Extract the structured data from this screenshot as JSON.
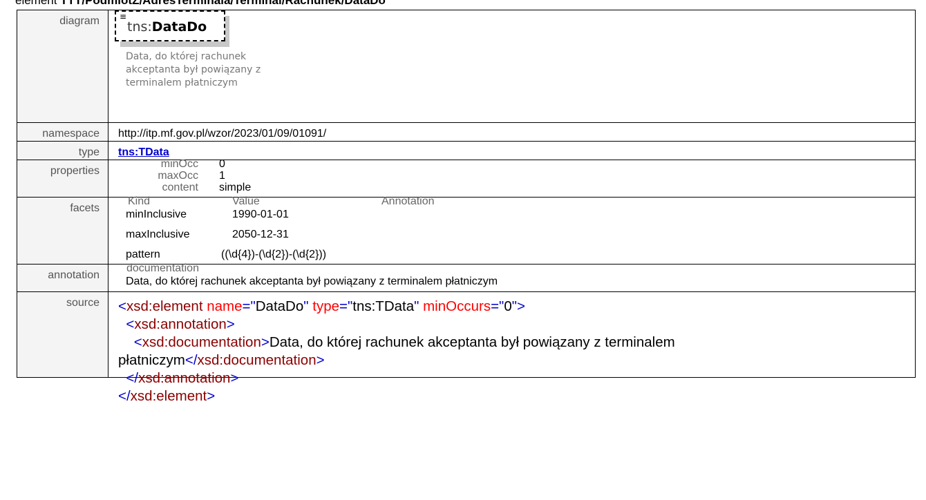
{
  "title": {
    "prefix": "element ",
    "path": "TTT/PodmiotZ/AdresTerminala/Terminal/Rachunek/DataDo"
  },
  "labels": {
    "diagram": "diagram",
    "namespace": "namespace",
    "type": "type",
    "properties": "properties",
    "facets": "facets",
    "annotation": "annotation",
    "source": "source"
  },
  "diagram": {
    "icon": "≡",
    "prefix": "tns:",
    "name": "DataDo",
    "doc_lines": [
      "Data, do której rachunek",
      "akceptanta był powiązany z",
      "terminalem płatniczym"
    ]
  },
  "namespace": "http://itp.mf.gov.pl/wzor/2023/01/09/01091/",
  "type": "tns:TData",
  "properties": [
    {
      "key": "minOcc",
      "value": "0"
    },
    {
      "key": "maxOcc",
      "value": "1"
    },
    {
      "key": "content",
      "value": "simple"
    }
  ],
  "facets": {
    "headers": [
      "Kind",
      "Value",
      "Annotation"
    ],
    "rows": [
      {
        "kind": "minInclusive",
        "value": "1990-01-01",
        "annotation": ""
      },
      {
        "kind": "maxInclusive",
        "value": "2050-12-31",
        "annotation": ""
      },
      {
        "kind": "pattern",
        "value": "((\\d{4})-(\\d{2})-(\\d{2}))",
        "annotation": ""
      }
    ]
  },
  "annotation": {
    "heading": "documentation",
    "text": "Data, do której rachunek akceptanta był powiązany z terminalem płatniczym"
  },
  "source": {
    "element_tag": "xsd:element",
    "attr_name_key": "name",
    "attr_name_val": "DataDo",
    "attr_type_key": "type",
    "attr_type_val": "tns:TData",
    "attr_min_key": "minOccurs",
    "attr_min_val": "0",
    "annotation_tag": "xsd:annotation",
    "documentation_tag": "xsd:documentation",
    "doc_line1": "Data, do której rachunek akceptanta był powiązany z terminalem",
    "doc_line2": "płatniczym"
  }
}
